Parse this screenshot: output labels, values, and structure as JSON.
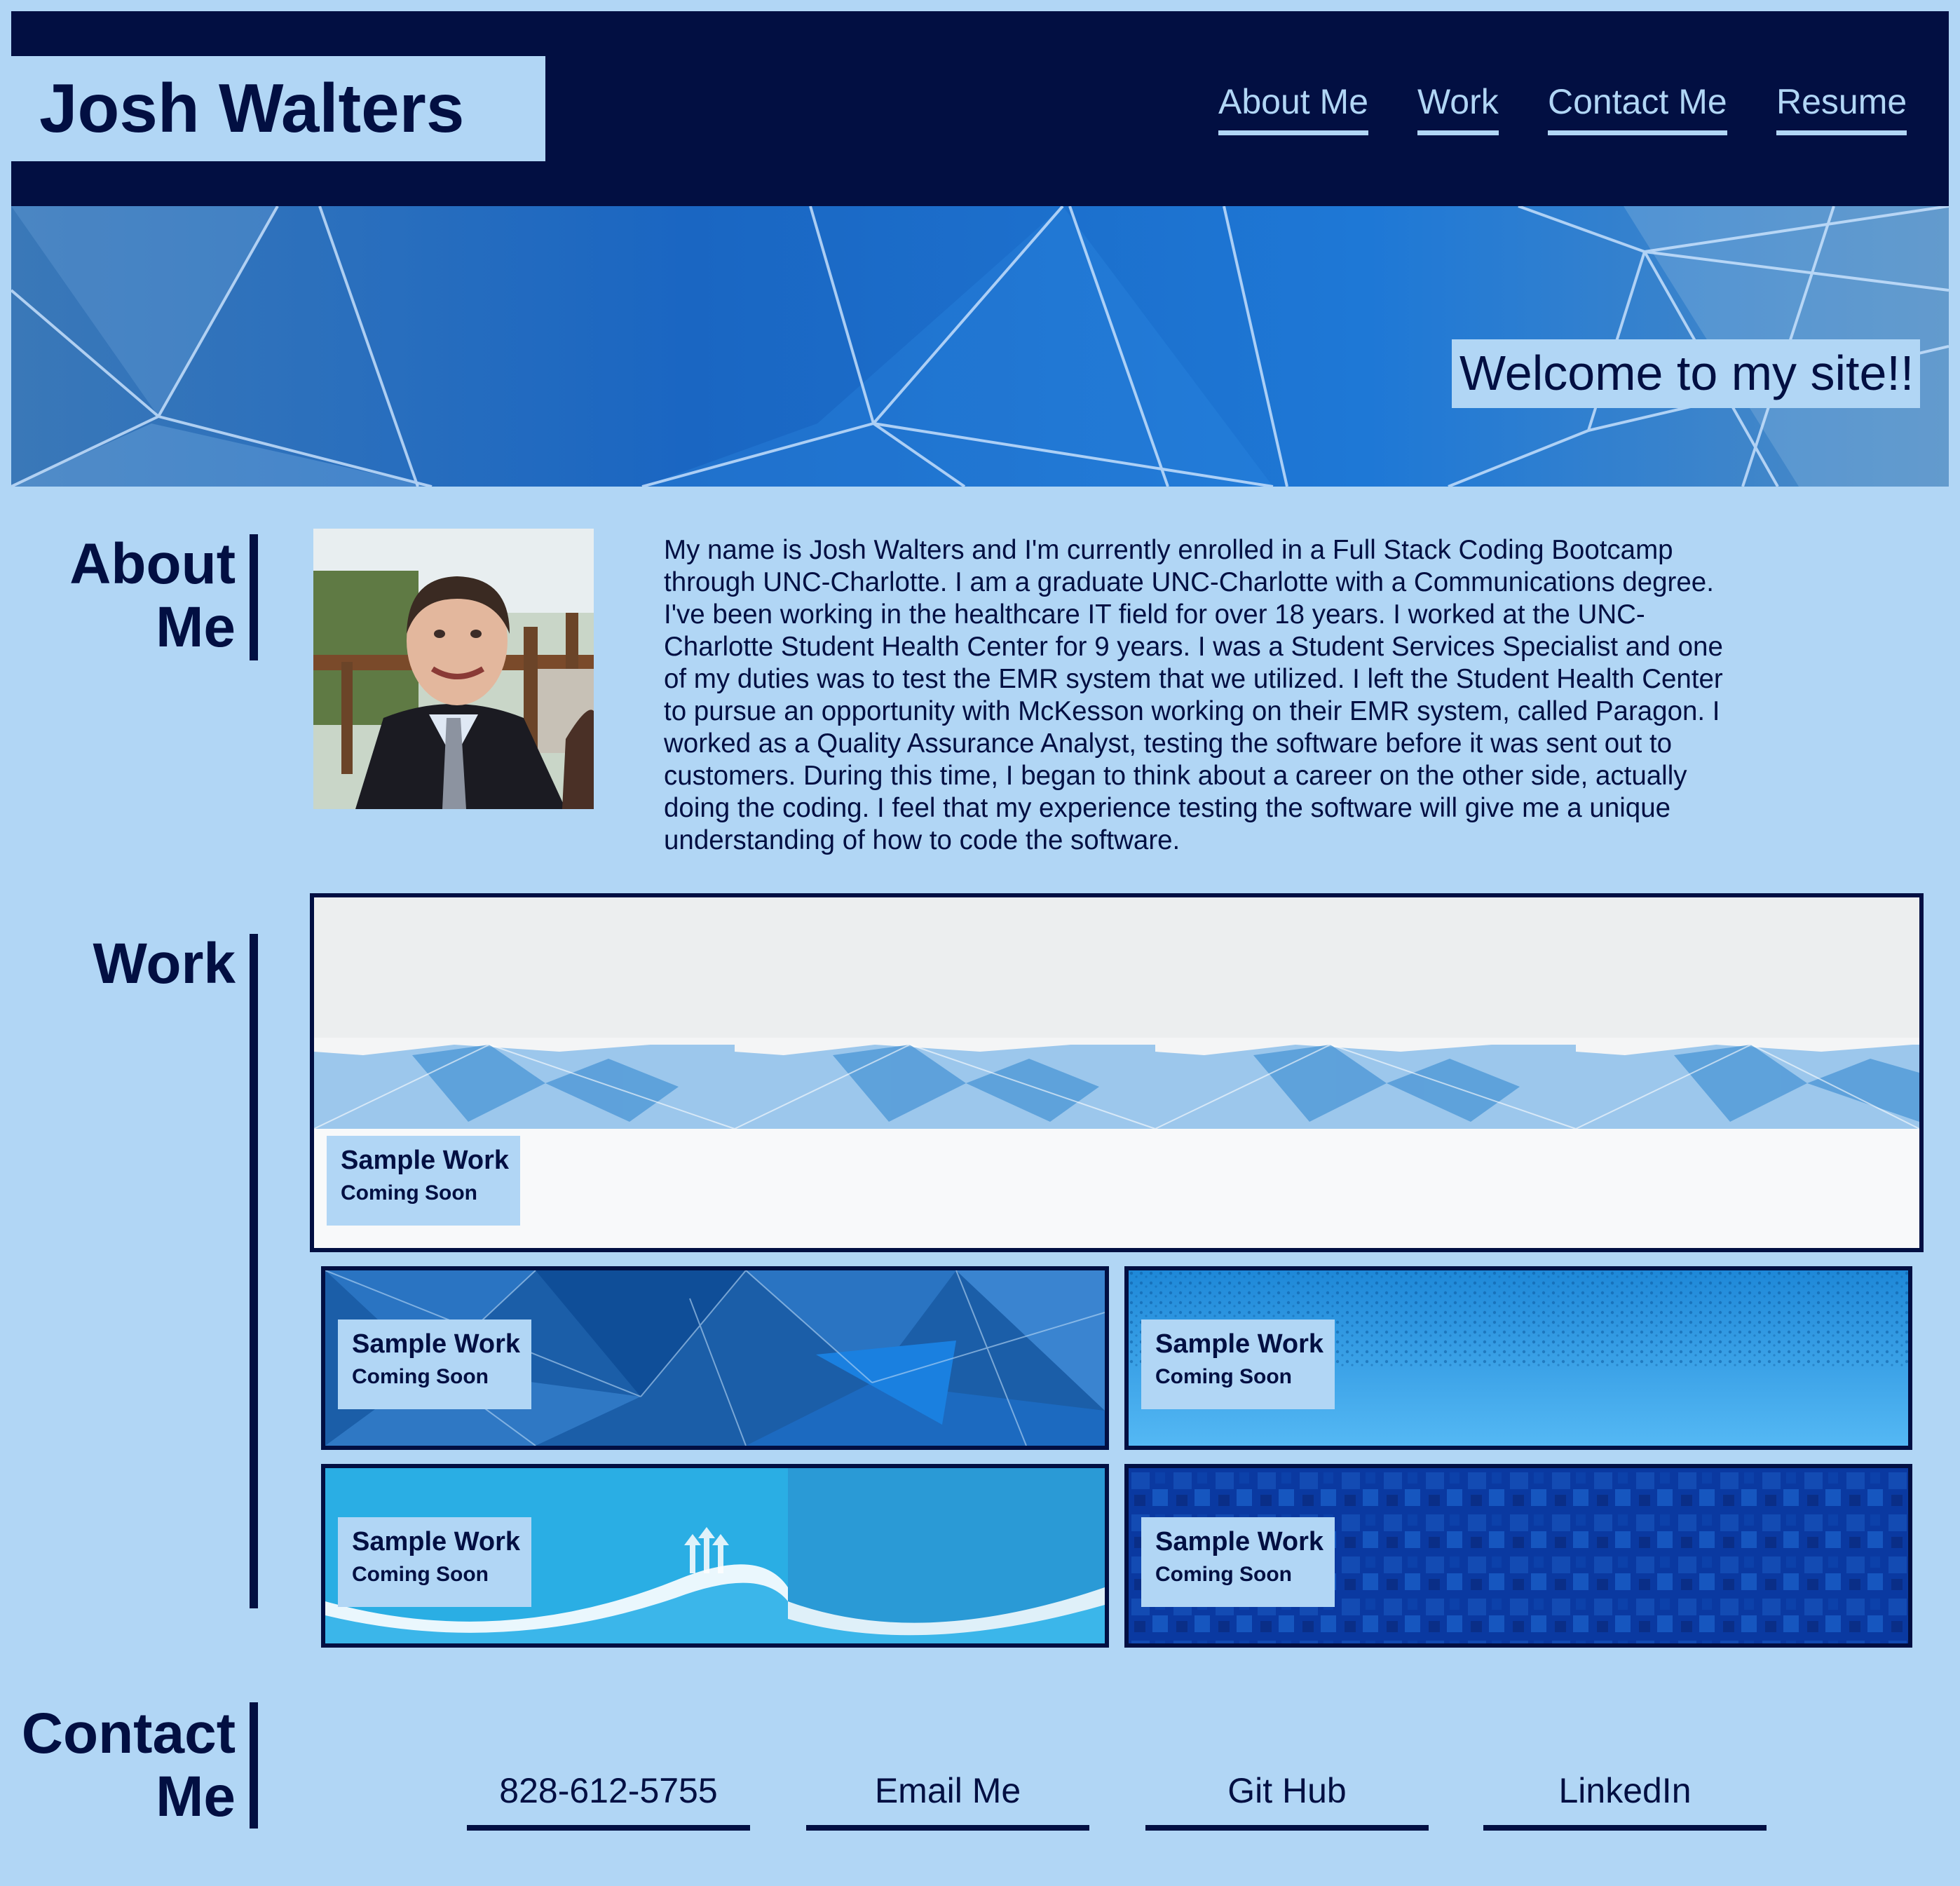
{
  "header": {
    "title": "Josh Walters",
    "nav": [
      "About Me",
      "Work",
      "Contact Me",
      "Resume"
    ]
  },
  "hero": {
    "welcome": "Welcome to my site!!"
  },
  "about": {
    "heading_line1": "About",
    "heading_line2": "Me",
    "paragraph": "My name is Josh Walters and I'm currently enrolled in a Full Stack Coding Bootcamp through UNC-Charlotte. I am a graduate UNC-Charlotte with a Communications degree. I've been working in the healthcare IT field for over 18 years. I worked at the UNC-Charlotte Student Health Center for 9 years. I was a Student Services Specialist and one of my duties was to test the EMR system that we utilized. I left the Student Health Center to pursue an opportunity with McKesson working on their EMR system, called Paragon. I worked as a Quality Assurance Analyst, testing the software before it was sent out to customers. During this time, I began to think about a career on the other side, actually doing the coding. I feel that my experience testing the software will give me a unique understanding of how to code the software."
  },
  "work": {
    "heading": "Work",
    "items": [
      {
        "title": "Sample Work",
        "subtitle": "Coming Soon"
      },
      {
        "title": "Sample Work",
        "subtitle": "Coming Soon"
      },
      {
        "title": "Sample Work",
        "subtitle": "Coming Soon"
      },
      {
        "title": "Sample Work",
        "subtitle": "Coming Soon"
      },
      {
        "title": "Sample Work",
        "subtitle": "Coming Soon"
      }
    ]
  },
  "contact": {
    "heading_line1": "Contact",
    "heading_line2": "Me",
    "links": [
      "828-612-5755",
      "Email Me",
      "Git Hub",
      "LinkedIn"
    ]
  },
  "colors": {
    "page_bg": "#b1d6f5",
    "navy": "#020f42",
    "hero_blue": "#1565c0"
  }
}
